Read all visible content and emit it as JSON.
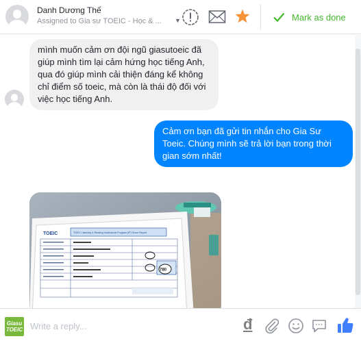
{
  "header": {
    "name": "Danh Dương Thế",
    "assignment": "Assigned to Gia sư TOEIC - Học & ...",
    "mark_done_label": "Mark as done",
    "icons": [
      "user-avatar",
      "alert-icon",
      "mail-icon",
      "star-icon",
      "check-icon"
    ],
    "colors": {
      "star": "#f7923a",
      "done": "#42b72a"
    }
  },
  "conversation": {
    "messages": [
      {
        "direction": "incoming",
        "text": "mình muốn cảm ơn đội ngũ giasutoeic đã giúp mình tìm lại cảm hứng học tiếng Anh, qua đó giúp mình cải thiện đáng kể không chỉ điểm số toeic, mà còn là thái độ đối với việc học tiếng Anh."
      },
      {
        "direction": "outgoing",
        "text": "Cảm ơn bạn đã gửi tin nhắn cho Gia Sư Toeic. Chúng mình sẽ trả lời bạn trong thời gian sớm nhất!"
      }
    ],
    "photo": {
      "description": "TOEIC score report photo",
      "doc_title": "TOEIC",
      "doc_subtitle": "TOEIC Listening & Reading Institutional Program (IP) Score Report",
      "score": "780"
    },
    "colors": {
      "incoming_bubble": "#f1f0f0",
      "outgoing_bubble": "#0084ff"
    }
  },
  "composer": {
    "logo_text": "Giasu TOEIC",
    "placeholder": "Write a reply...",
    "icons": [
      "dong-icon",
      "paperclip-icon",
      "smiley-icon",
      "saved-reply-icon",
      "like-icon"
    ],
    "dong_symbol": "đ"
  }
}
